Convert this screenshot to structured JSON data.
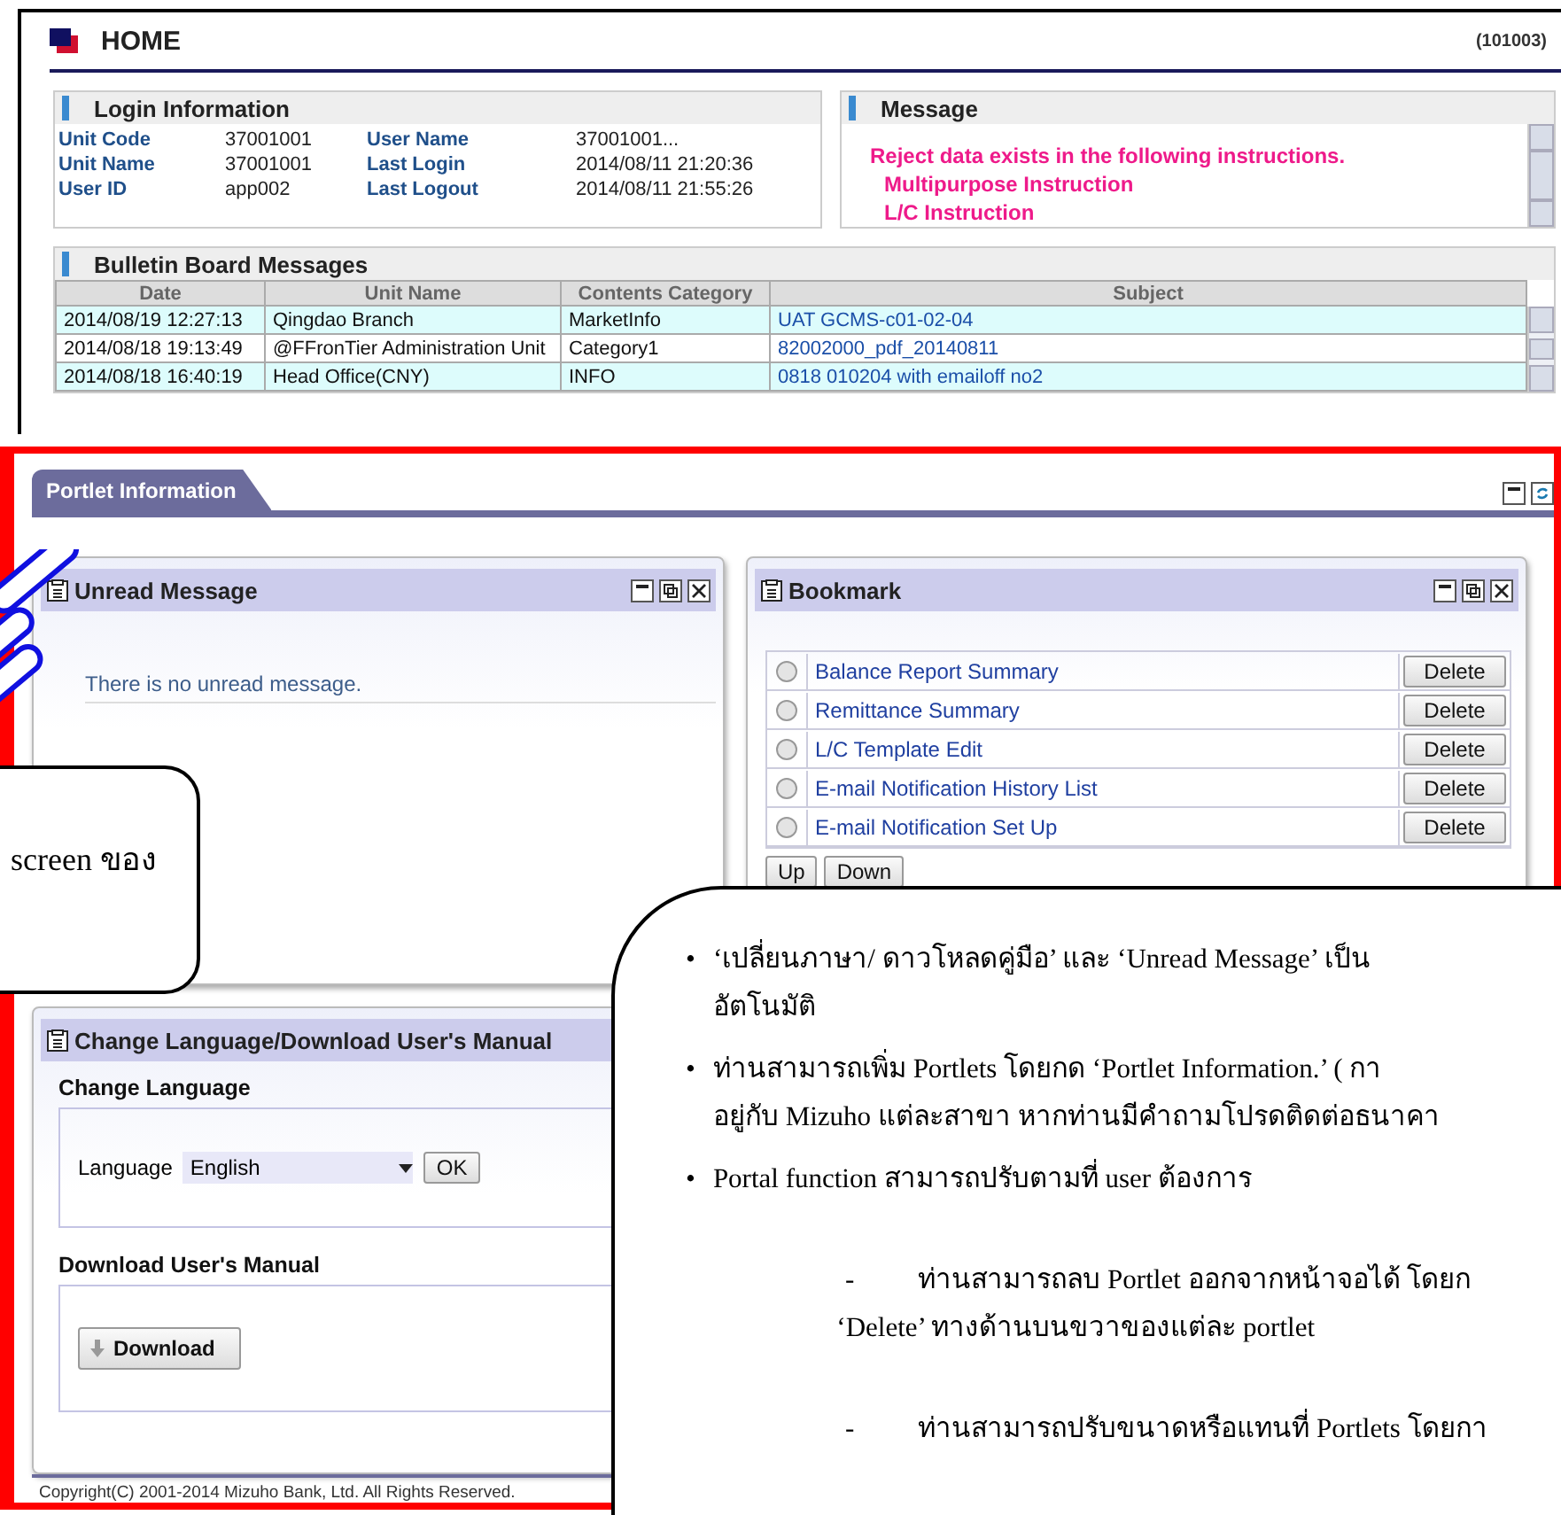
{
  "header": {
    "title": "HOME",
    "screen_id": "(101003)"
  },
  "login_info": {
    "title": "Login Information",
    "fields": [
      {
        "label": "Unit Code",
        "value": "37001001"
      },
      {
        "label": "User Name",
        "value": "37001001..."
      },
      {
        "label": "Unit Name",
        "value": "37001001"
      },
      {
        "label": "Last Login",
        "value": "2014/08/11 21:20:36"
      },
      {
        "label": "User ID",
        "value": "app002"
      },
      {
        "label": "Last Logout",
        "value": "2014/08/11 21:55:26"
      }
    ]
  },
  "message": {
    "title": "Message",
    "lines": [
      {
        "kind": "heading",
        "text": "Reject data exists in the following instructions."
      },
      {
        "kind": "item",
        "text": "Multipurpose Instruction"
      },
      {
        "kind": "item",
        "text": "L/C Instruction"
      }
    ]
  },
  "bulletin": {
    "title": "Bulletin Board Messages",
    "columns": [
      "Date",
      "Unit Name",
      "Contents Category",
      "Subject"
    ],
    "rows": [
      {
        "cells": [
          "2014/08/19 12:27:13",
          "Qingdao Branch",
          "MarketInfo",
          "UAT GCMS-c01-02-04"
        ]
      },
      {
        "cells": [
          "2014/08/18 19:13:49",
          "@FFronTier Administration Unit",
          "Category1",
          "82002000_pdf_20140811"
        ]
      },
      {
        "cells": [
          "2014/08/18 16:40:19",
          "Head Office(CNY)",
          "INFO",
          "0818 010204 with emailoff no2"
        ]
      }
    ]
  },
  "portlet_tab": {
    "label": "Portlet Information"
  },
  "unread": {
    "title": "Unread Message",
    "text": "There is no unread message."
  },
  "bookmark": {
    "title": "Bookmark",
    "items": [
      {
        "label": "Balance Report Summary",
        "selected": false,
        "action": "Delete"
      },
      {
        "label": "Remittance Summary",
        "selected": false,
        "action": "Delete"
      },
      {
        "label": "L/C Template Edit",
        "selected": false,
        "action": "Delete"
      },
      {
        "label": "E-mail Notification History List",
        "selected": false,
        "action": "Delete"
      },
      {
        "label": "E-mail Notification Set Up",
        "selected": false,
        "action": "Delete"
      }
    ],
    "buttons": [
      "Up",
      "Down"
    ]
  },
  "language_portlet": {
    "title": "Change Language/Download User's Manual",
    "change_title": "Change Language",
    "language_label": "Language",
    "language_value": "English",
    "ok": "OK",
    "download_title": "Download User's Manual",
    "download_button": "Download"
  },
  "footer": "Copyright(C) 2001-2014 Mizuho Bank, Ltd. All Rights Reserved.",
  "left_callout": {
    "text": "screen ของ"
  },
  "right_callout": {
    "items": [
      {
        "kind": "bullet",
        "marker": "•",
        "lines": [
          "‘เปลี่ยนภาษา/ ดาวโหลดคู่มือ’ และ ‘Unread Message’ เป็น",
          "อัตโนมัติ"
        ]
      },
      {
        "kind": "bullet",
        "marker": "•",
        "lines": [
          "ท่านสามารถเพิ่ม Portlets โดยกด ‘Portlet Information.’ ( กา",
          "อยู่กับ Mizuho แต่ละสาขา หากท่านมีคำถามโปรดติดต่อธนาคา"
        ]
      },
      {
        "kind": "bullet",
        "marker": "•",
        "lines": [
          "Portal function สามารถปรับตามที่ user ต้องการ"
        ]
      },
      {
        "kind": "dash",
        "marker": "-",
        "lines": [
          "ท่านสามารถลบ Portlet ออกจากหน้าจอได้ โดยก",
          "‘Delete’ ทางด้านบนขวาของแต่ละ portlet"
        ]
      },
      {
        "kind": "dash",
        "marker": "-",
        "lines": [
          "ท่านสามารถปรับขนาดหรือแทนที่ Portlets โดยกา"
        ]
      }
    ]
  }
}
